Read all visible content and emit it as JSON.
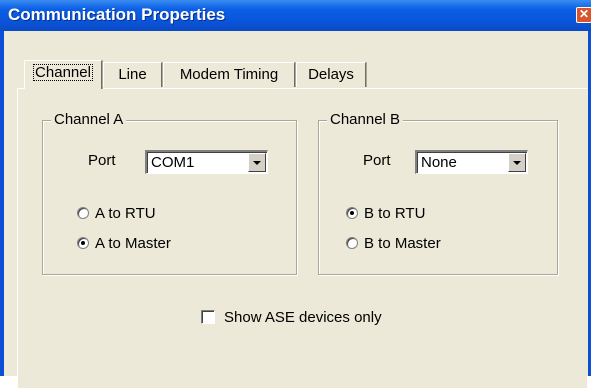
{
  "window": {
    "title": "Communication Properties",
    "close_glyph": "✕"
  },
  "tabs": [
    {
      "label": "Channel",
      "active": true
    },
    {
      "label": "Line",
      "active": false
    },
    {
      "label": "Modem Timing",
      "active": false
    },
    {
      "label": "Delays",
      "active": false
    }
  ],
  "channel_a": {
    "group_label": "Channel A",
    "port_label": "Port",
    "port_value": "COM1",
    "options": [
      {
        "label": "A to RTU",
        "checked": false
      },
      {
        "label": "A to Master",
        "checked": true
      }
    ]
  },
  "channel_b": {
    "group_label": "Channel B",
    "port_label": "Port",
    "port_value": "None",
    "options": [
      {
        "label": "B to RTU",
        "checked": true
      },
      {
        "label": "B to Master",
        "checked": false
      }
    ]
  },
  "show_ase": {
    "label": "Show ASE devices only",
    "checked": false
  },
  "icons": {
    "close": "close-icon",
    "dropdown": "chevron-down-icon"
  },
  "colors": {
    "titlebar": "#0a54d9",
    "face": "#ece9d8",
    "close": "#d9532c"
  }
}
